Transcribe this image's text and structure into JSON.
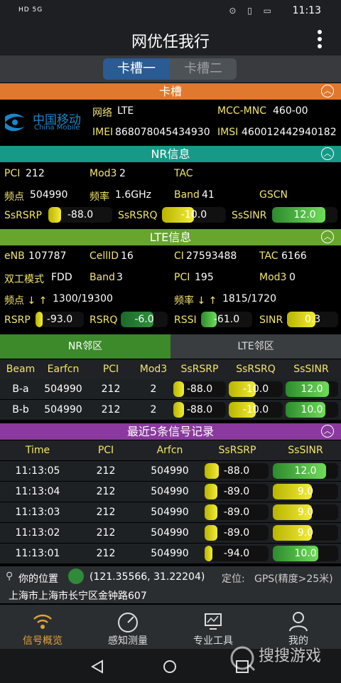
{
  "statusbar": {
    "left": "HD 5G",
    "time": "11:13",
    "icons": "⊙ ▯ ▭"
  },
  "app": {
    "title": "网优任我行"
  },
  "slots": {
    "tab1": "卡槽一",
    "tab2": "卡槽二"
  },
  "sim": {
    "header": "卡槽",
    "carrier_cn": "中国移动",
    "carrier_en": "China Mobile",
    "network_label": "网络",
    "network_value": "LTE",
    "mcc_label": "MCC-MNC",
    "mcc_value": "460-00",
    "imei_label": "IMEI",
    "imei_value": "868078045434930",
    "imsi_label": "IMSI",
    "imsi_value": "460012442940182"
  },
  "nr": {
    "header": "NR信息",
    "pci_label": "PCI",
    "pci_value": "212",
    "mod3_label": "Mod3",
    "mod3_value": "2",
    "tac_label": "TAC",
    "tac_value": "",
    "freqpt_label": "频点",
    "freqpt_value": "504990",
    "freq_label": "频率",
    "freq_value": "1.6GHz",
    "band_label": "Band",
    "band_value": "41",
    "gscn_label": "GSCN",
    "gscn_value": "",
    "ssrsrp_label": "SsRSRP",
    "ssrsrp_value": "-88.0",
    "ssrsrp_level": 0.2,
    "ssrsrq_label": "SsRSRQ",
    "ssrsrq_value": "-10.0",
    "ssrsrq_level": 0.5,
    "sssinr_label": "SsSINR",
    "sssinr_value": "12.0",
    "sssinr_level": 0.82
  },
  "lte": {
    "header": "LTE信息",
    "enb_label": "eNB",
    "enb_value": "107787",
    "cellid_label": "CellID",
    "cellid_value": "16",
    "ci_label": "CI",
    "ci_value": "27593488",
    "tac_label": "TAC",
    "tac_value": "6166",
    "duplex_label": "双工模式",
    "duplex_value": "FDD",
    "band_label": "Band",
    "band_value": "3",
    "pci_label": "PCI",
    "pci_value": "195",
    "mod3_label": "Mod3",
    "mod3_value": "0",
    "freqpt_label": "频点 ↓ ↑",
    "freqpt_value": "1300/19300",
    "freq_label": "频率 ↓ ↑",
    "freq_value": "1815/1720",
    "rsrp_label": "RSRP",
    "rsrp_value": "-93.0",
    "rsrp_level": 0.15,
    "rsrq_label": "RSRQ",
    "rsrq_value": "-6.0",
    "rsrq_level": 0.7,
    "rssi_label": "RSSI",
    "rssi_value": "-61.0",
    "rssi_level": 0.3,
    "sinr_label": "SINR",
    "sinr_value": "0.3",
    "sinr_level": 0.55
  },
  "neighbors": {
    "tab_nr": "NR邻区",
    "tab_lte": "LTE邻区",
    "columns": [
      "Beam",
      "Earfcn",
      "PCI",
      "Mod3",
      "SsRSRP",
      "SsRSRQ",
      "SsSINR"
    ],
    "rows": [
      {
        "beam": "B-a",
        "earfcn": "504990",
        "pci": "212",
        "mod3": "2",
        "ssrsrp": "-88.0",
        "ssrsrp_level": 0.2,
        "ssrsrq": "-10.0",
        "ssrsrq_level": 0.5,
        "sssinr": "12.0",
        "sssinr_level": 0.82
      },
      {
        "beam": "B-b",
        "earfcn": "504990",
        "pci": "212",
        "mod3": "2",
        "ssrsrp": "-88.0",
        "ssrsrp_level": 0.2,
        "ssrsrq": "-10.0",
        "ssrsrq_level": 0.5,
        "sssinr": "10.0",
        "sssinr_level": 0.75
      }
    ]
  },
  "history": {
    "header": "最近5条信号记录",
    "columns": [
      "Time",
      "PCI",
      "Arfcn",
      "SsRSRP",
      "SsSINR"
    ],
    "rows": [
      {
        "time": "11:13:05",
        "pci": "212",
        "arfcn": "504990",
        "ssrsrp": "-88.0",
        "ssrsrp_level": 0.22,
        "sssinr": "12.0",
        "sssinr_level": 0.82,
        "sinr_color": "green"
      },
      {
        "time": "11:13:04",
        "pci": "212",
        "arfcn": "504990",
        "ssrsrp": "-89.0",
        "ssrsrp_level": 0.2,
        "sssinr": "9.0",
        "sssinr_level": 0.6,
        "sinr_color": "yellow"
      },
      {
        "time": "11:13:03",
        "pci": "212",
        "arfcn": "504990",
        "ssrsrp": "-89.0",
        "ssrsrp_level": 0.2,
        "sssinr": "9.0",
        "sssinr_level": 0.6,
        "sinr_color": "yellow"
      },
      {
        "time": "11:13:02",
        "pci": "212",
        "arfcn": "504990",
        "ssrsrp": "-89.0",
        "ssrsrp_level": 0.2,
        "sssinr": "9.0",
        "sssinr_level": 0.6,
        "sinr_color": "yellow"
      },
      {
        "time": "11:13:01",
        "pci": "212",
        "arfcn": "504990",
        "ssrsrp": "-94.0",
        "ssrsrp_level": 0.12,
        "sssinr": "10.0",
        "sssinr_level": 0.7,
        "sinr_color": "green"
      }
    ]
  },
  "location": {
    "label": "你的位置",
    "coords": "(121.35566, 31.22204)",
    "locate_label": "定位:",
    "locate_value": "GPS(精度>25米)",
    "address": "上海市上海市长宁区金钟路607"
  },
  "nav": {
    "items": [
      {
        "label": "信号概览",
        "icon": "wifi-icon"
      },
      {
        "label": "感知测量",
        "icon": "gauge-icon"
      },
      {
        "label": "专业工具",
        "icon": "monitor-icon"
      },
      {
        "label": "我的",
        "icon": "person-icon"
      }
    ]
  },
  "watermark": {
    "text": "搜搜游戏"
  },
  "colors": {
    "orange": "#e0782d",
    "teal": "#169a87",
    "green": "#67a52d",
    "purple": "#8a3a9e",
    "label_yellow": "#f2e56b",
    "active_nav": "#e0a33a"
  }
}
